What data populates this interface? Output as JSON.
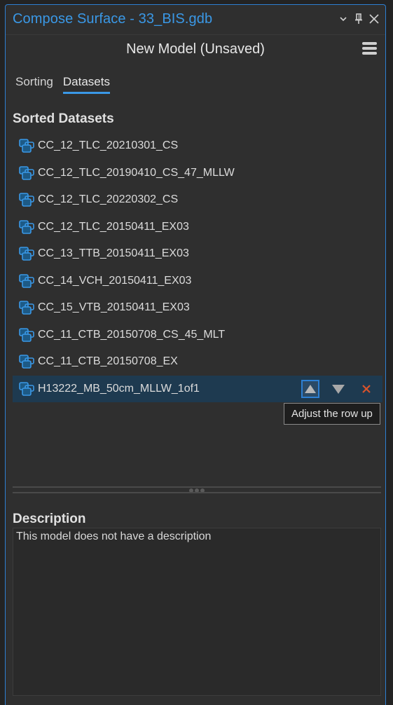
{
  "window": {
    "title": "Compose Surface - 33_BIS.gdb",
    "controls": [
      {
        "name": "options-dropdown",
        "icon": "chevron-down-icon",
        "glyph": "⌄"
      },
      {
        "name": "pin",
        "icon": "pin-icon",
        "glyph": "📌"
      },
      {
        "name": "close",
        "icon": "close-icon",
        "glyph": "✕"
      }
    ]
  },
  "header": {
    "model_title": "New Model (Unsaved)",
    "menu_icon": "hamburger-menu-icon"
  },
  "tabs": [
    {
      "label": "Sorting",
      "active": false
    },
    {
      "label": "Datasets",
      "active": true
    }
  ],
  "sorted_datasets": {
    "title": "Sorted Datasets",
    "items": [
      {
        "label": "CC_12_TLC_20210301_CS",
        "selected": false
      },
      {
        "label": "CC_12_TLC_20190410_CS_47_MLLW",
        "selected": false
      },
      {
        "label": "CC_12_TLC_20220302_CS",
        "selected": false
      },
      {
        "label": "CC_12_TLC_20150411_EX03",
        "selected": false
      },
      {
        "label": "CC_13_TTB_20150411_EX03",
        "selected": false
      },
      {
        "label": "CC_14_VCH_20150411_EX03",
        "selected": false
      },
      {
        "label": "CC_15_VTB_20150411_EX03",
        "selected": false
      },
      {
        "label": "CC_11_CTB_20150708_CS_45_MLT",
        "selected": false
      },
      {
        "label": "CC_11_CTB_20150708_EX",
        "selected": false
      },
      {
        "label": "H13222_MB_50cm_MLLW_1of1",
        "selected": true
      }
    ],
    "row_actions": {
      "move_up_icon": "triangle-up-icon",
      "move_down_icon": "triangle-down-icon",
      "remove_icon": "remove-x-icon"
    },
    "tooltip": "Adjust the row up"
  },
  "description": {
    "title": "Description",
    "value": "This model does not have a description"
  },
  "colors": {
    "accent": "#2d7fd3",
    "title_text": "#3a98e6",
    "selected_row": "#1e3a50",
    "remove": "#d9532b",
    "background": "#2f2f2f"
  }
}
